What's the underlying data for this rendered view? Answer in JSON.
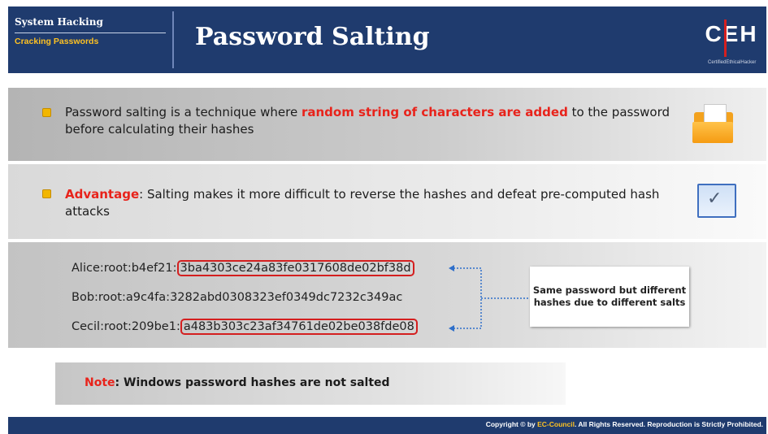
{
  "header": {
    "section": "System Hacking",
    "subsection": "Cracking Passwords",
    "title": "Password Salting",
    "logo_text": "CEH",
    "logo_tags": [
      "Certified",
      "Ethical",
      "Hacker"
    ]
  },
  "bullet1": {
    "text_before": "Password salting is a technique where ",
    "highlight": "random string of characters are added",
    "text_after": " to the password before calculating their hashes"
  },
  "bullet2": {
    "label": "Advantage",
    "text": ": Salting makes it more difficult to reverse the hashes and defeat pre-computed hash attacks"
  },
  "hashes": [
    {
      "prefix": "Alice:root:b4ef21:",
      "hash": "3ba4303ce24a83fe0317608de02bf38d",
      "boxed": true
    },
    {
      "prefix": "Bob:root:a9c4fa:",
      "hash": "3282abd0308323ef0349dc7232c349ac",
      "boxed": false
    },
    {
      "prefix": "Cecil:root:209be1:",
      "hash": "a483b303c23af34761de02be038fde08",
      "boxed": true
    }
  ],
  "callout": "Same password but different hashes due to different salts",
  "note": {
    "label": "Note",
    "text": ": Windows password hashes are not salted"
  },
  "footer": {
    "before": "Copyright © by ",
    "brand": "EC-Council",
    "after": ". All Rights Reserved. Reproduction is Strictly Prohibited."
  },
  "colors": {
    "header_blue": "#1f3b6e",
    "accent_red": "#e8231b",
    "bullet_yellow": "#f2b600",
    "connector_blue": "#2f6fc9"
  },
  "icons": [
    "folder-icon",
    "checkbox-icon",
    "bullet-icon"
  ]
}
